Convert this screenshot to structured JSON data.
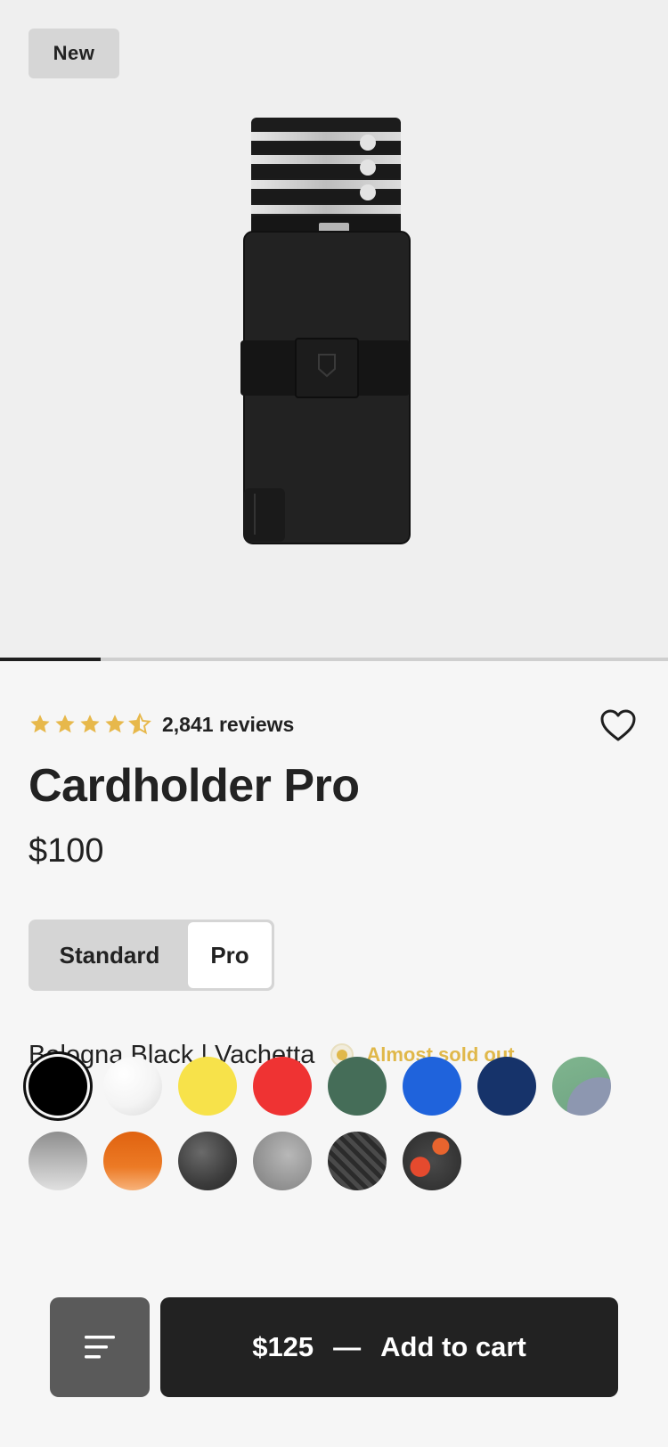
{
  "hero": {
    "badge": "New",
    "gallery_progress": 0.15
  },
  "rating": {
    "stars": 4.5,
    "reviews_label": "2,841 reviews",
    "star_color": "#e7b84b"
  },
  "product": {
    "title": "Cardholder Pro",
    "price": "$100"
  },
  "variant_toggle": {
    "options": [
      "Standard",
      "Pro"
    ],
    "selected": "Pro"
  },
  "color": {
    "selected_name": "Bologna Black | Vachetta",
    "stock_status": "Almost sold out",
    "status_color": "#e0b84a",
    "swatches": [
      {
        "name": "black",
        "color": "#000000"
      },
      {
        "name": "white",
        "color": "#ffffff"
      },
      {
        "name": "yellow",
        "color": "#f7e24a"
      },
      {
        "name": "red",
        "color": "#ef3333"
      },
      {
        "name": "green",
        "color": "#456d58"
      },
      {
        "name": "blue",
        "color": "#1f63dc"
      },
      {
        "name": "navy",
        "color": "#16336a"
      },
      {
        "name": "sage-pattern",
        "color": "#7cae8b"
      },
      {
        "name": "silver",
        "color": "#a6a6a6"
      },
      {
        "name": "orange",
        "color": "#e86a14"
      },
      {
        "name": "dark-marble",
        "color": "#4a4a4a"
      },
      {
        "name": "grey-marble",
        "color": "#9c9c9c"
      },
      {
        "name": "carbon-fiber",
        "color": "#3a3a3a"
      },
      {
        "name": "lava",
        "color": "#333333"
      }
    ]
  },
  "footer": {
    "menu_icon": "menu-lines-icon",
    "cart_price": "$125",
    "cart_separator": "—",
    "cart_label": "Add to cart"
  }
}
